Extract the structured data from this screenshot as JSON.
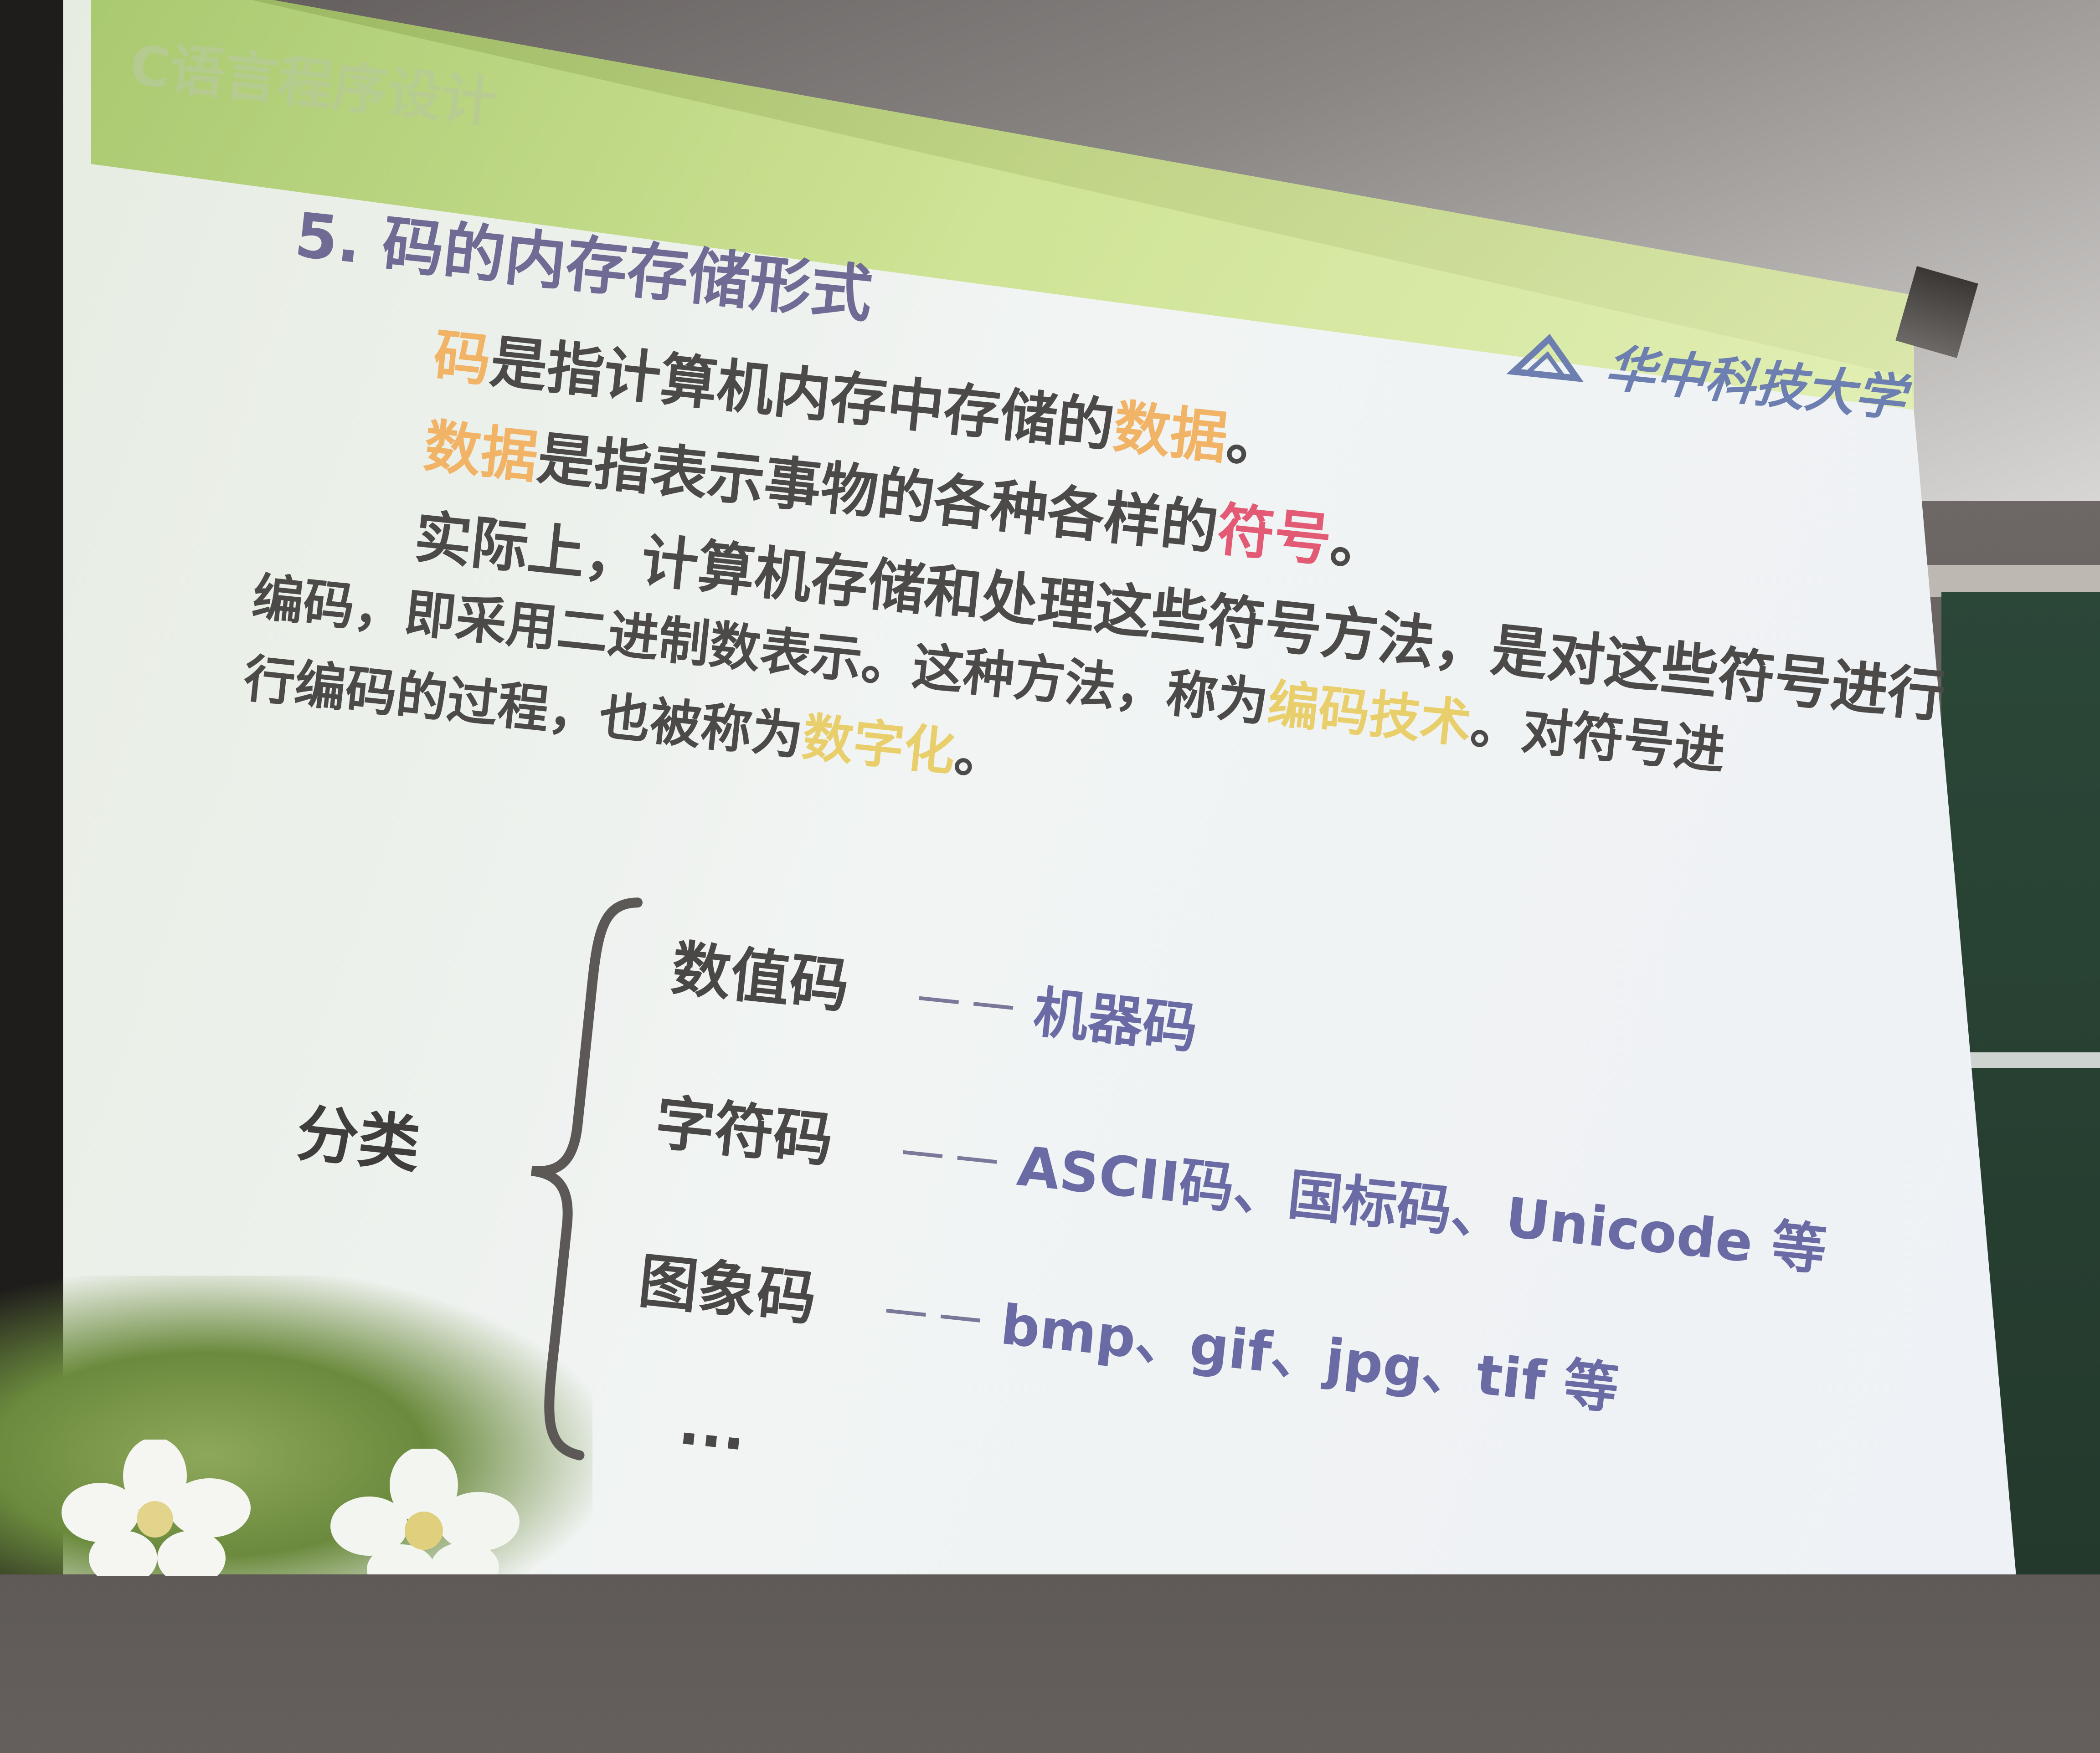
{
  "slide": {
    "course_title": "C语言程序设计",
    "section_title": "5. 码的内存存储形式",
    "logo_text": "华中科技大学",
    "lines": [
      {
        "segments": [
          {
            "text": "码",
            "hl": "orange"
          },
          {
            "text": "是指计算机内存中存储的"
          },
          {
            "text": "数据",
            "hl": "orange"
          },
          {
            "text": "。"
          }
        ]
      },
      {
        "segments": [
          {
            "text": "数据",
            "hl": "orange"
          },
          {
            "text": "是指表示事物的各种各样的"
          },
          {
            "text": "符号",
            "hl": "red"
          },
          {
            "text": "。"
          }
        ]
      },
      {
        "segments": [
          {
            "text": "实际上，计算机存储和处理这些符号方法，是对这些符号进行"
          }
        ]
      },
      {
        "segments": [
          {
            "text": "编码，即采用二进制数表示。这种方法，称为"
          },
          {
            "text": "编码技术",
            "hl": "yellow"
          },
          {
            "text": "。对符号进"
          }
        ]
      },
      {
        "segments": [
          {
            "text": "行编码的过程，也被称为"
          },
          {
            "text": "数字化",
            "hl": "yellow"
          },
          {
            "text": "。"
          }
        ]
      }
    ],
    "classification": {
      "label": "分类",
      "items": [
        {
          "name": "数值码",
          "dash": "－－",
          "desc": "机器码"
        },
        {
          "name": "字符码",
          "dash": "－－",
          "desc": "ASCII码、国标码、Unicode 等"
        },
        {
          "name": "图象码",
          "dash": "－－",
          "desc": "bmp、gif、jpg、tif 等"
        }
      ],
      "ellipsis": "..."
    }
  }
}
